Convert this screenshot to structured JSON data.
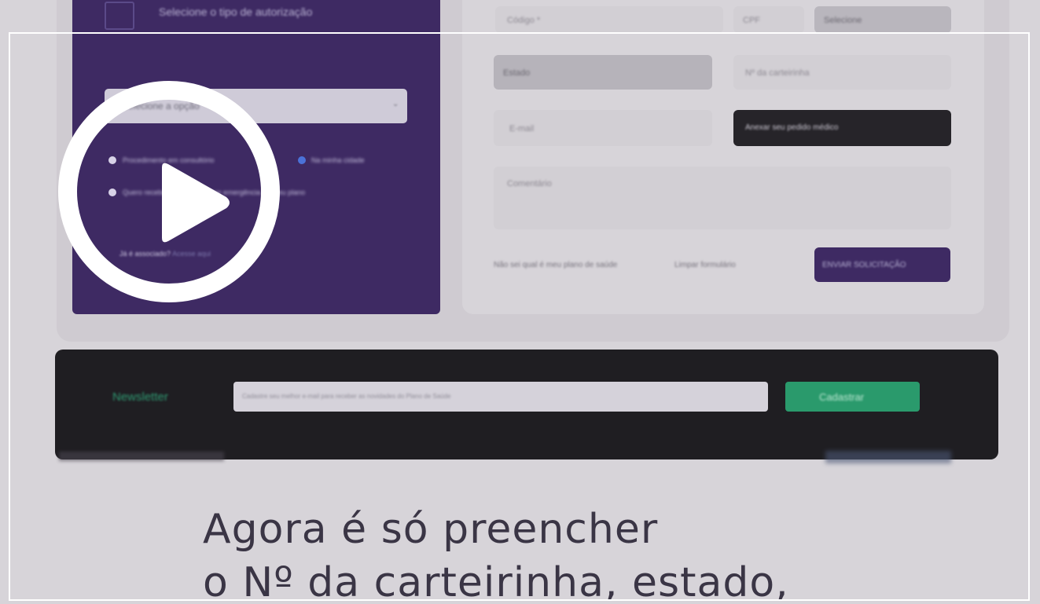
{
  "video": {
    "title_lines": [
      "Agora é só preencher",
      "o Nº da carteirinha, estado,"
    ],
    "play_icon": "play-icon"
  },
  "left_panel": {
    "title": "Selecione o tipo de autorização",
    "select_placeholder": "Selecione a opção",
    "radio_1": "Procedimento em consultório",
    "radio_2": "Na minha cidade",
    "radio_3": "Quero receber em outra via por emergência do meu plano",
    "link_prefix": "Já é associado?",
    "link_text": "Acesse aqui"
  },
  "form": {
    "field_1": "Código *",
    "field_2_a": "CPF",
    "field_2_b": "Selecione",
    "field_3": "Estado",
    "field_4": "Nº da carteirinha",
    "field_5": "E-mail",
    "field_6": "Comentário",
    "dark_button": "Anexar seu pedido médico",
    "link_1": "Não sei qual é meu plano de saúde",
    "link_2": "Limpar formulário",
    "submit_button": "ENVIAR SOLICITAÇÃO"
  },
  "newsletter": {
    "label": "Newsletter",
    "input_placeholder": "Cadastre seu melhor e-mail para receber as novidades do Plano de Saúde",
    "button": "Cadastrar"
  },
  "colors": {
    "brand_purple": "#3e2a63",
    "accent_green": "#2a9a6c",
    "dark": "#1f1e22"
  }
}
